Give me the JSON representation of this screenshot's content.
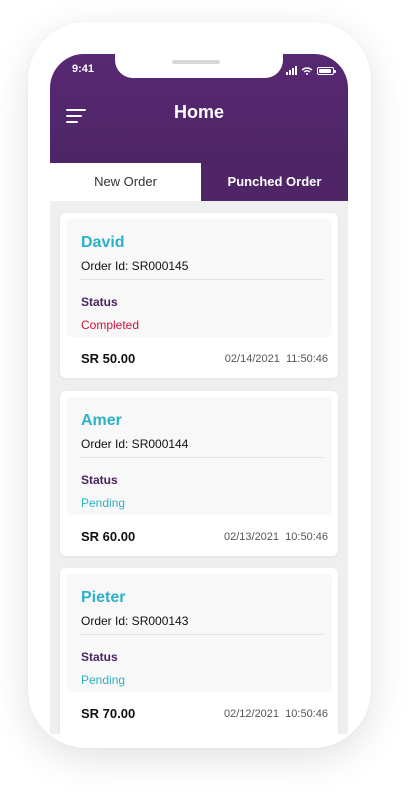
{
  "status_bar": {
    "time": "9:41"
  },
  "header": {
    "title": "Home",
    "menu_icon": "hamburger-menu-icon"
  },
  "tabs": [
    {
      "label": "New Order",
      "active": false
    },
    {
      "label": "Punched Order",
      "active": true
    }
  ],
  "orders": [
    {
      "name": "David",
      "order_id": "Order Id: SR000145",
      "status_label": "Status",
      "status": "Completed",
      "amount": "SR 50.00",
      "date": "02/14/2021",
      "time": "11:50:46"
    },
    {
      "name": "Amer",
      "order_id": "Order Id: SR000144",
      "status_label": "Status",
      "status": "Pending",
      "amount": "SR 60.00",
      "date": "02/13/2021",
      "time": "10:50:46"
    },
    {
      "name": "Pieter",
      "order_id": "Order Id: SR000143",
      "status_label": "Status",
      "status": "Pending",
      "amount": "SR 70.00",
      "date": "02/12/2021",
      "time": "10:50:46"
    }
  ],
  "colors": {
    "header": "#582873",
    "accent": "#2bb2c8",
    "completed": "#d0103a",
    "status_label": "#4a2460"
  }
}
